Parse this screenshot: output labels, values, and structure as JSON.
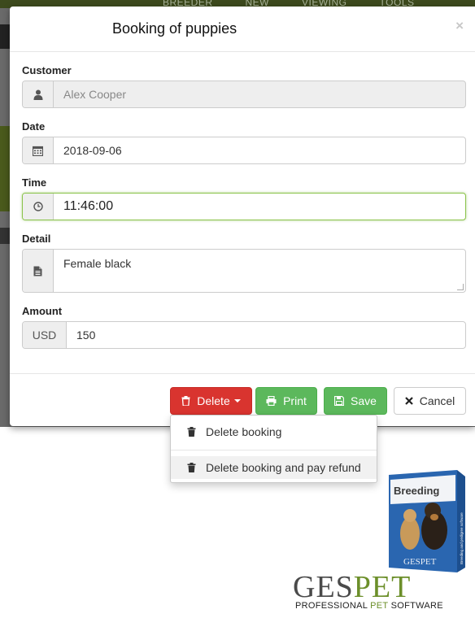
{
  "background": {
    "nav": [
      "BREEDER",
      "NEW",
      "VIEWING",
      "TOOLS"
    ]
  },
  "modal": {
    "title": "Booking of puppies",
    "close": "×"
  },
  "form": {
    "customer_label": "Customer",
    "customer_value": "Alex Cooper",
    "date_label": "Date",
    "date_value": "2018-09-06",
    "time_label": "Time",
    "time_value": "11:46:00",
    "detail_label": "Detail",
    "detail_value": "Female black",
    "amount_label": "Amount",
    "currency": "USD",
    "amount_value": "150"
  },
  "footer": {
    "delete_label": "Delete",
    "print_label": "Print",
    "save_label": "Save",
    "cancel_label": "Cancel"
  },
  "dropdown": {
    "items": [
      "Delete booking",
      "Delete booking and pay refund"
    ]
  },
  "branding": {
    "box_title": "Breeding",
    "box_side": "Breeding and pedigree software",
    "box_logo": "GESPET",
    "logo_part1": "GES",
    "logo_part2": "PET",
    "tagline_part1": "PROFESSIONAL ",
    "tagline_part2": "PET",
    "tagline_part3": " SOFTWARE"
  },
  "colors": {
    "danger": "#d9342f",
    "success": "#5cb85c",
    "focus": "#8bc34a",
    "brand_green": "#6c8f2a"
  }
}
